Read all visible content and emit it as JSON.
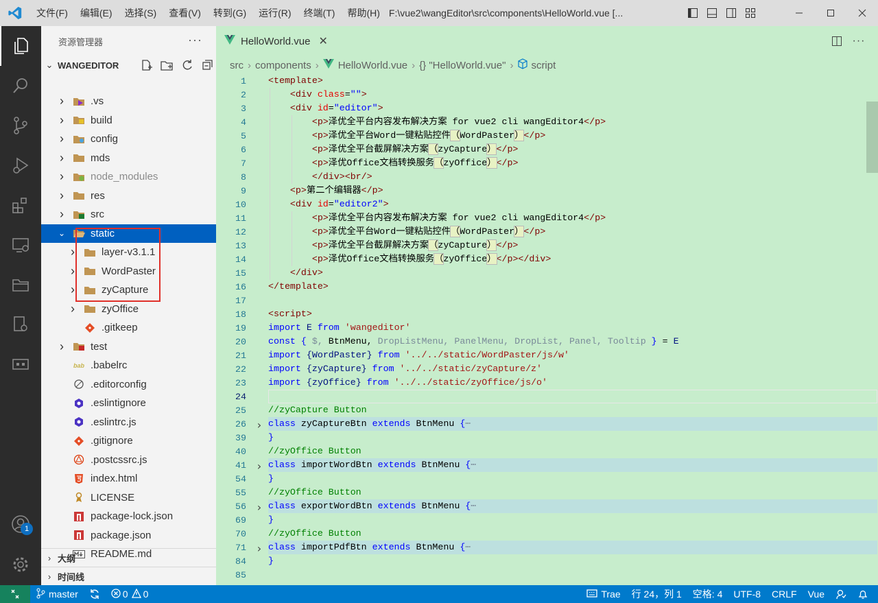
{
  "titlebar": {
    "menus": [
      "文件(F)",
      "编辑(E)",
      "选择(S)",
      "查看(V)",
      "转到(G)",
      "运行(R)",
      "终端(T)",
      "帮助(H)"
    ],
    "title": "F:\\vue2\\wangEditor\\src\\components\\HelloWorld.vue [..."
  },
  "activity": {
    "account_badge": "1"
  },
  "sidebar": {
    "header": "资源管理器",
    "more": "···",
    "root": "WANGEDITOR",
    "items": [
      {
        "label": ".vs",
        "icon": "vs-folder-icon"
      },
      {
        "label": "build",
        "icon": "build-folder-icon"
      },
      {
        "label": "config",
        "icon": "config-folder-icon"
      },
      {
        "label": "mds",
        "icon": "folder-icon"
      },
      {
        "label": "node_modules",
        "icon": "node-folder-icon"
      },
      {
        "label": "res",
        "icon": "folder-icon"
      },
      {
        "label": "src",
        "icon": "src-folder-icon"
      },
      {
        "label": "static",
        "icon": "open-folder-icon"
      },
      {
        "label": "layer-v3.1.1",
        "icon": "folder-icon"
      },
      {
        "label": "WordPaster",
        "icon": "folder-icon"
      },
      {
        "label": "zyCapture",
        "icon": "folder-icon"
      },
      {
        "label": "zyOffice",
        "icon": "folder-icon"
      },
      {
        "label": ".gitkeep",
        "icon": "git-icon"
      },
      {
        "label": "test",
        "icon": "test-folder-icon"
      },
      {
        "label": ".babelrc",
        "icon": "babel-icon"
      },
      {
        "label": ".editorconfig",
        "icon": "editorconfig-icon"
      },
      {
        "label": ".eslintignore",
        "icon": "eslint-icon"
      },
      {
        "label": ".eslintrc.js",
        "icon": "eslint-icon"
      },
      {
        "label": ".gitignore",
        "icon": "git-icon"
      },
      {
        "label": ".postcssrc.js",
        "icon": "postcss-icon"
      },
      {
        "label": "index.html",
        "icon": "html5-icon"
      },
      {
        "label": "LICENSE",
        "icon": "license-icon"
      },
      {
        "label": "package-lock.json",
        "icon": "npm-icon"
      },
      {
        "label": "package.json",
        "icon": "npm-icon"
      },
      {
        "label": "README.md",
        "icon": "markdown-icon"
      }
    ],
    "outline": "大纲",
    "timeline": "时间线"
  },
  "editor": {
    "tab": "HelloWorld.vue",
    "breadcrumbs": [
      "src",
      "components",
      "HelloWorld.vue",
      "{} \"HelloWorld.vue\"",
      "script"
    ],
    "line_numbers": [
      "1",
      "2",
      "3",
      "4",
      "5",
      "6",
      "7",
      "8",
      "9",
      "10",
      "11",
      "12",
      "13",
      "14",
      "15",
      "16",
      "17",
      "18",
      "19",
      "20",
      "21",
      "22",
      "23",
      "24",
      "25",
      "26",
      "39",
      "40",
      "41",
      "54",
      "55",
      "56",
      "69",
      "70",
      "71",
      "84",
      "85"
    ],
    "current_line": "24"
  },
  "status": {
    "branch": "master",
    "errors": "0",
    "warnings": "0",
    "trae": "Trae",
    "position": "行 24，列 1",
    "spaces": "空格: 4",
    "encoding": "UTF-8",
    "eol": "CRLF",
    "language": "Vue"
  },
  "colors": {
    "accent": "#007acc",
    "editor_bg": "#c7edcc",
    "selection": "#0060c0",
    "highlight_box": "#e0302a"
  }
}
